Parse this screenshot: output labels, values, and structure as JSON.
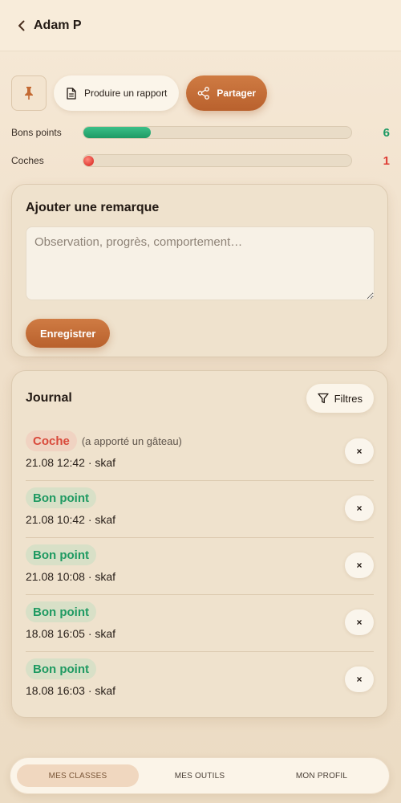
{
  "header": {
    "title": "Adam P",
    "back_icon": "chevron-left-icon"
  },
  "actions": {
    "pin_icon": "pin-icon",
    "report_label": "Produire un rapport",
    "report_icon": "document-icon",
    "share_label": "Partager",
    "share_icon": "share-icon"
  },
  "stats": [
    {
      "label": "Bons points",
      "value": "6",
      "progress": 0.25,
      "color": "#1e9a64"
    },
    {
      "label": "Coches",
      "value": "1",
      "progress": 0.02,
      "color": "#de3b33"
    }
  ],
  "remark": {
    "title": "Ajouter une remarque",
    "placeholder": "Observation, progrès, comportement…",
    "value": "",
    "save_label": "Enregistrer"
  },
  "journal": {
    "title": "Journal",
    "filter_label": "Filtres",
    "filter_icon": "filter-icon",
    "delete_label": "×",
    "entries": [
      {
        "type": "Coche",
        "note": "(a apporté un gâteau)",
        "meta": "21.08 12:42 · skaf"
      },
      {
        "type": "Bon point",
        "note": "",
        "meta": "21.08 10:42 · skaf"
      },
      {
        "type": "Bon point",
        "note": "",
        "meta": "21.08 10:08 · skaf"
      },
      {
        "type": "Bon point",
        "note": "",
        "meta": "18.08 16:05 · skaf"
      },
      {
        "type": "Bon point",
        "note": "",
        "meta": "18.08 16:03 · skaf"
      }
    ]
  },
  "nav": {
    "items": [
      {
        "label": "MES CLASSES",
        "active": true
      },
      {
        "label": "MES OUTILS",
        "active": false
      },
      {
        "label": "MON PROFIL",
        "active": false
      }
    ]
  },
  "colors": {
    "accent": "#c46a33",
    "green": "#1e9a64",
    "red": "#de3b33"
  }
}
